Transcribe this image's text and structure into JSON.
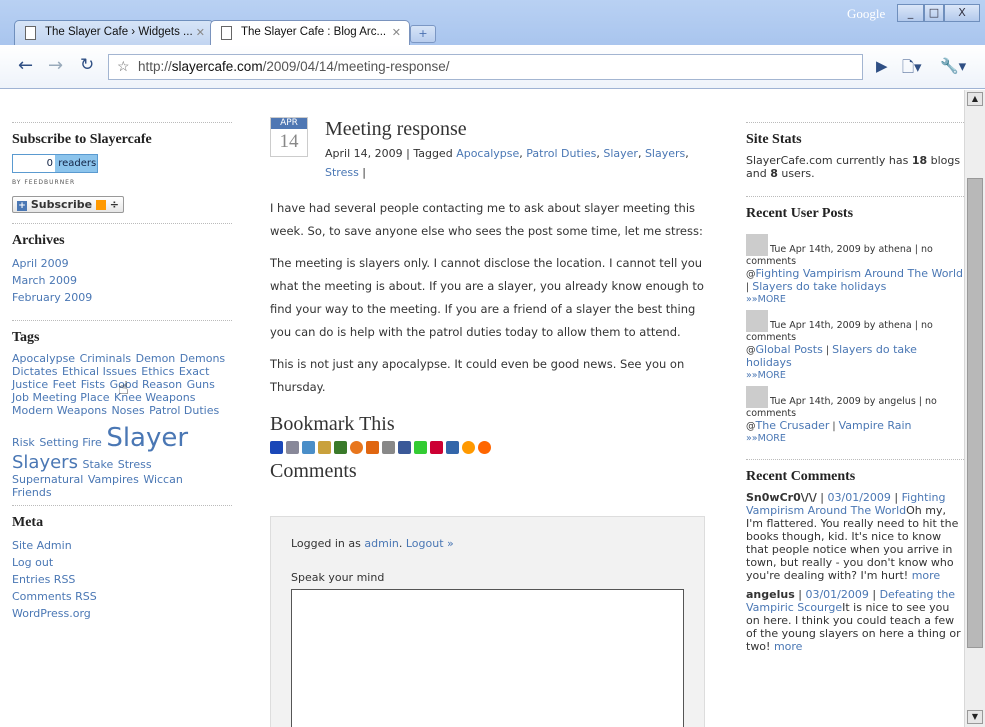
{
  "browser": {
    "tabs": [
      {
        "label": "The Slayer Cafe › Widgets ..."
      },
      {
        "label": "The Slayer Cafe : Blog Arc..."
      }
    ],
    "brand": "Google",
    "url_prefix": "http://",
    "url_domain": "slayercafe.com",
    "url_path": "/2009/04/14/meeting-response/"
  },
  "left_sidebar": {
    "subscribe_title": "Subscribe to Slayercafe",
    "reader_count": "0",
    "readers_label": "readers",
    "feedburner_label": "BY FEEDBURNER",
    "subscribe_button": "Subscribe",
    "archives_title": "Archives",
    "archives": [
      "April 2009",
      "March 2009",
      "February 2009"
    ],
    "tags_title": "Tags",
    "tags": [
      "Apocalypse",
      "Criminals",
      "Demon",
      "Demons",
      "Dictates",
      "Ethical Issues",
      "Ethics",
      "Exact",
      "Justice",
      "Feet",
      "Fists",
      "Good Reason",
      "Guns",
      "Job Meeting Place",
      "Knee Weapons",
      "Modern Weapons",
      "Noses",
      "Patrol Duties",
      "Risk",
      "Setting Fire",
      "Slayer",
      "Slayers",
      "Stake",
      "Stress",
      "Supernatural",
      "Vampires",
      "Wiccan",
      "Friends"
    ],
    "meta_title": "Meta",
    "meta_links": [
      "Site Admin",
      "Log out",
      "Entries RSS",
      "Comments RSS",
      "WordPress.org"
    ]
  },
  "post": {
    "month": "APR",
    "day": "14",
    "title": "Meeting response",
    "date": "April 14, 2009",
    "tagged_label": "Tagged",
    "tags": [
      "Apocalypse",
      "Patrol Duties",
      "Slayer",
      "Slayers",
      "Stress"
    ],
    "paragraphs": [
      "I have had several people contacting me to ask about slayer meeting this week. So, to save anyone else who sees the post some time, let me stress:",
      "The meeting is slayers only. I cannot disclose the location. I cannot tell you what the meeting is about. If you are a slayer, you already know enough to find your way to the meeting. If you are a friend of a slayer the best thing you can do is help with the patrol duties today to allow them to attend.",
      "This is not just any apocalypse. It could even be good news. See you on Thursday."
    ],
    "bookmark_title": "Bookmark This",
    "comments_title": "Comments",
    "logged_in_prefix": "Logged in as",
    "user": "admin",
    "logout": "Logout »",
    "speak_label": "Speak your mind"
  },
  "right_sidebar": {
    "stats_title": "Site Stats",
    "stats_prefix": "SlayerCafe.com currently has",
    "blogs_count": "18",
    "blogs_word": "blogs and",
    "users_count": "8",
    "users_word": "users.",
    "recent_posts_title": "Recent User Posts",
    "recent_posts": [
      {
        "meta": "Tue Apr 14th, 2009 by athena | no comments",
        "at": "@",
        "link1": "Fighting Vampirism Around The World",
        "link2": "Slayers do take holidays",
        "more": "»»MORE"
      },
      {
        "meta": "Tue Apr 14th, 2009 by athena | no comments",
        "at": "@",
        "link1": "Global Posts",
        "link2": "Slayers do take holidays",
        "more": "»»MORE"
      },
      {
        "meta": "Tue Apr 14th, 2009 by angelus | no comments",
        "at": "@",
        "link1": "The Crusader",
        "link2": "Vampire Rain",
        "more": "»»MORE"
      }
    ],
    "recent_comments_title": "Recent Comments",
    "recent_comments": [
      {
        "author": "Sn0wCr0\\/\\/",
        "date": "03/01/2009",
        "post": "Fighting Vampirism Around The World",
        "text": "Oh my, I'm flattered. You really need to hit the books though, kid. It's nice to know that people notice when you arrive in town, but really - you don't know who you're dealing with? I'm hurt!",
        "more": "more"
      },
      {
        "author": "angelus",
        "date": "03/01/2009",
        "post": "Defeating the Vampiric Scourge",
        "text": "It is nice to see you on here. I think you could teach a few of the young slayers on here a thing or two!",
        "more": "more"
      }
    ]
  },
  "colors": {
    "link": "#4a77b4",
    "accent": "#4f77b3"
  }
}
